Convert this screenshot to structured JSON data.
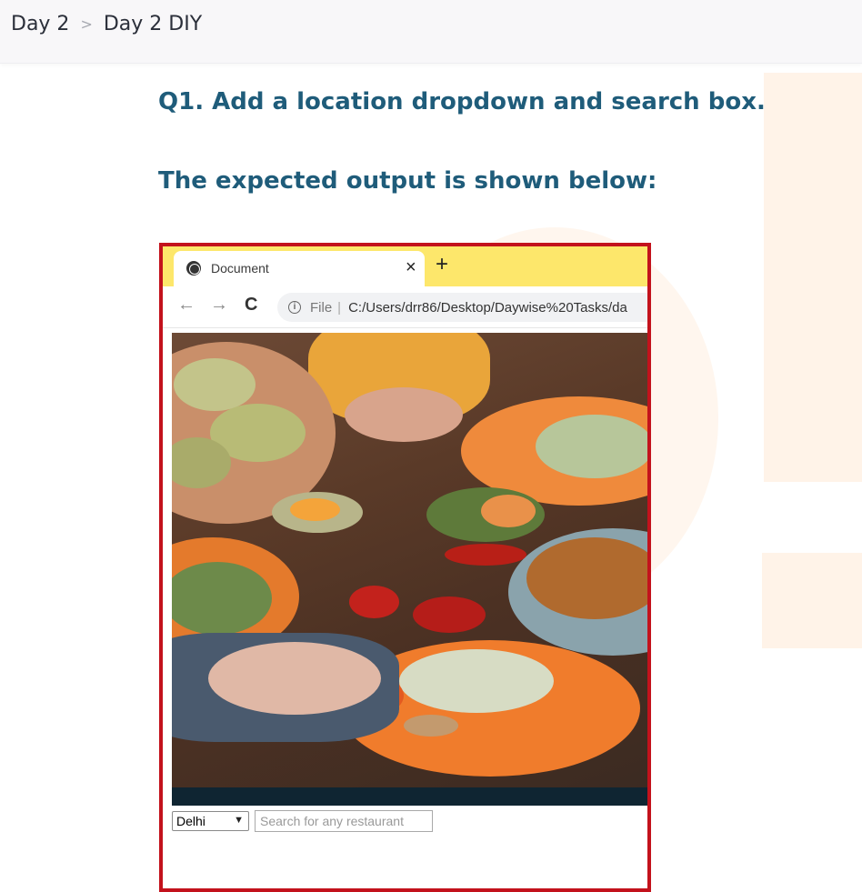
{
  "breadcrumb": {
    "items": [
      {
        "label": "Day 2"
      },
      {
        "label": "Day 2 DIY"
      }
    ],
    "separator": ">"
  },
  "content": {
    "question": "Q1. Add a location dropdown and search box.",
    "expected_output_label": "The expected output is shown below:"
  },
  "expected_output": {
    "frame_color": "#c3121c",
    "browser": {
      "tab_title": "Document",
      "tab_close": "×",
      "new_tab": "+",
      "back": "←",
      "forward": "→",
      "reload": "C",
      "url_scheme": "File",
      "url_separator": "|",
      "url_path": "C:/Users/drr86/Desktop/Daywise%20Tasks/da",
      "tab_bar_color": "#fde76b"
    },
    "image_subject": "food-table",
    "location_select": {
      "value": "Delhi"
    },
    "search_input": {
      "placeholder": "Search for any restaurant"
    }
  },
  "icons": {
    "globe": "globe-icon",
    "info": "info-icon",
    "chevron": "chevron-down-icon"
  },
  "colors": {
    "heading": "#1f5c7a",
    "watermark": "#fff3e8"
  }
}
